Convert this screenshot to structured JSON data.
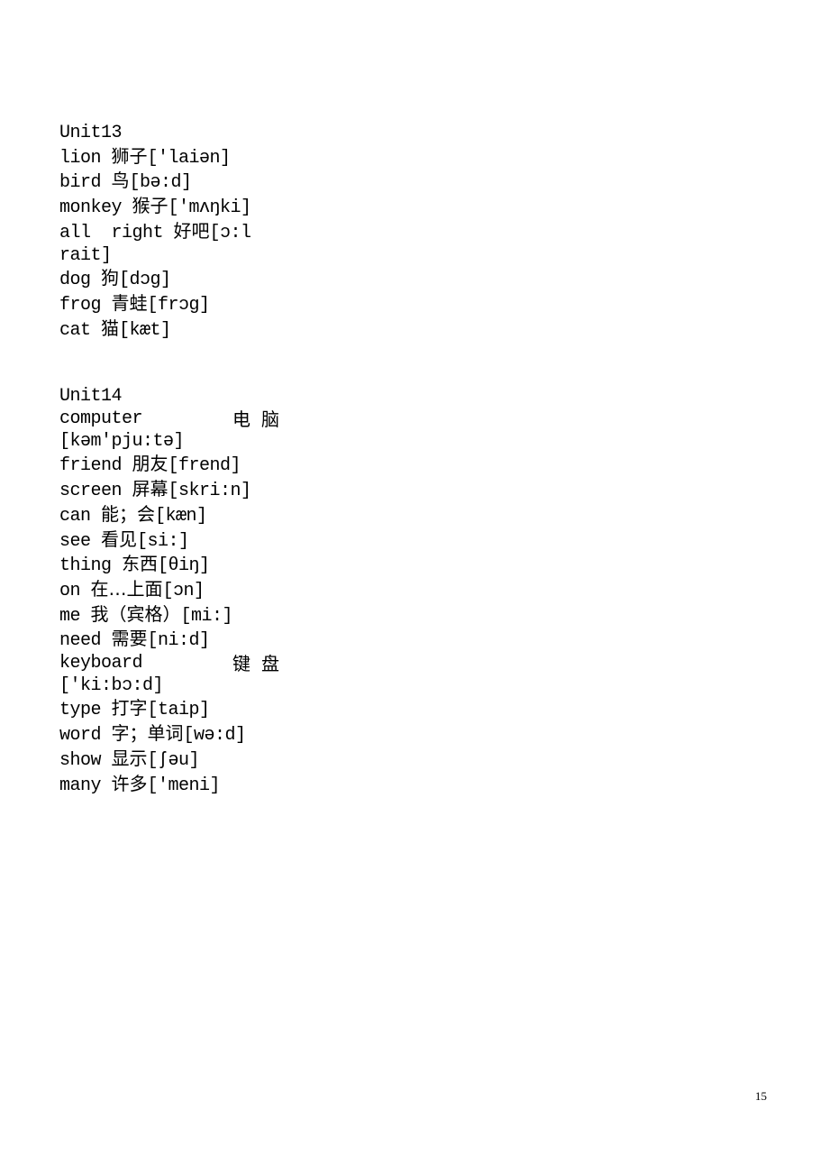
{
  "units": [
    {
      "title": "Unit13",
      "entries": [
        {
          "word": "lion",
          "cn": "狮子",
          "ipa": "['laiən]"
        },
        {
          "word": "bird",
          "cn": "鸟",
          "ipa": "[bə:d]"
        },
        {
          "word": "monkey",
          "cn": "猴子",
          "ipa": "['mʌŋki]"
        },
        {
          "word": "all  right",
          "cn": "好吧",
          "ipa": "[ɔ:l",
          "ipa_cont": "rait]"
        },
        {
          "word": "dog",
          "cn": "狗",
          "ipa": "[dɔg]"
        },
        {
          "word": "frog",
          "cn": "青蛙",
          "ipa": "[frɔg]"
        },
        {
          "word": "cat",
          "cn": "猫",
          "ipa": "[kæt]"
        }
      ]
    },
    {
      "title": "Unit14",
      "entries": [
        {
          "word": "computer",
          "cn": "电脑",
          "ipa": "[kəm'pju:tə]"
        },
        {
          "word": "friend",
          "cn": "朋友",
          "ipa": "[frend]"
        },
        {
          "word": "screen",
          "cn": "屏幕",
          "ipa": "[skri:n]"
        },
        {
          "word": "can",
          "cn": "能；会",
          "ipa": "[kæn]"
        },
        {
          "word": "see",
          "cn": "看见",
          "ipa": "[si:]"
        },
        {
          "word": "thing",
          "cn": "东西",
          "ipa": "[θiŋ]"
        },
        {
          "word": "on",
          "cn": "在…上面",
          "ipa": "[ɔn]"
        },
        {
          "word": "me",
          "cn": "我（宾格）",
          "ipa": "[mi:]"
        },
        {
          "word": "need",
          "cn": "需要",
          "ipa": "[ni:d]"
        },
        {
          "word": "keyboard",
          "cn": "键盘",
          "ipa": "['ki:bɔ:d]"
        },
        {
          "word": "type",
          "cn": "打字",
          "ipa": "[taip]"
        },
        {
          "word": "word",
          "cn": "字；单词",
          "ipa": "[wə:d]"
        },
        {
          "word": "show",
          "cn": "显示",
          "ipa": "[ʃəu]"
        },
        {
          "word": "many",
          "cn": "许多",
          "ipa": "['meni]"
        }
      ]
    }
  ],
  "page_number": "15"
}
